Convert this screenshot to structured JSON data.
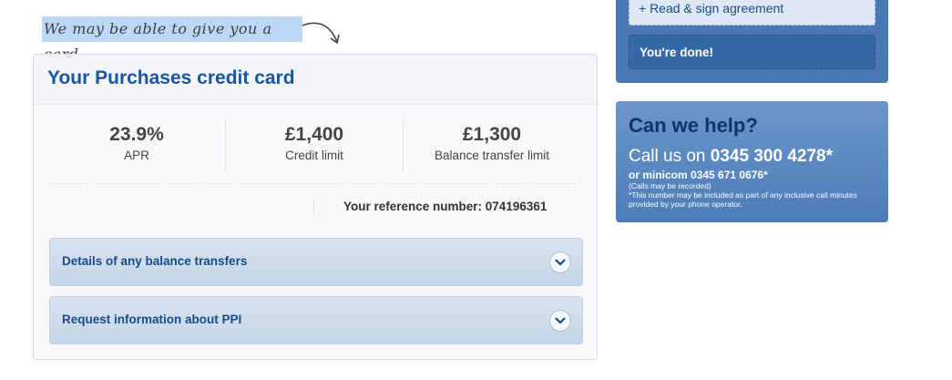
{
  "note": {
    "text": "We may be able to give you a card"
  },
  "card": {
    "title": "Your Purchases credit card",
    "stats": [
      {
        "value": "23.9%",
        "label": "APR"
      },
      {
        "value": "£1,400",
        "label": "Credit limit"
      },
      {
        "value": "£1,300",
        "label": "Balance transfer limit"
      }
    ],
    "reference": "Your reference number: 074196361",
    "accordions": [
      {
        "label": "Details of any balance transfers"
      },
      {
        "label": "Request information about PPI"
      }
    ]
  },
  "steps": {
    "read_sign": "+ Read & sign agreement",
    "done": "You're done!"
  },
  "help": {
    "title": "Can we help?",
    "call_prefix": "Call us on ",
    "call_number": "0345 300 4278*",
    "minicom": "or minicom 0345 671 0676*",
    "recorded": "(Calls may be recorded)",
    "disclaimer": "*This number may be included as part of any inclusive call minutes provided by your phone operator."
  },
  "colors": {
    "brand_blue": "#1a56a0",
    "panel_blue": "#4a78b2",
    "help_title": "#0f3567"
  }
}
